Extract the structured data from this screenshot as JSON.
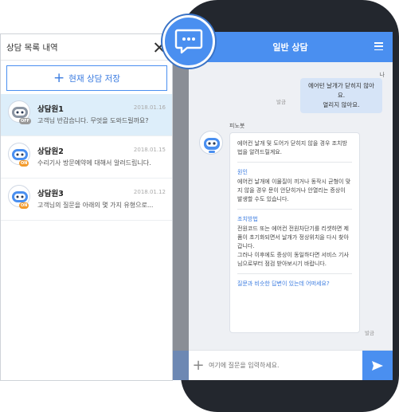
{
  "panel": {
    "title": "상담 목록 내역",
    "save_label": "현재 상담 저장",
    "items": [
      {
        "name": "상담원1",
        "date": "2018.01.16",
        "preview": "고객님 반갑습니다. 무엇을 도와드릴까요?",
        "status": "OFF"
      },
      {
        "name": "상담원2",
        "date": "2018.01.15",
        "preview": "수리기사 방문예약에 대해서 알려드립니다.",
        "status": "ON"
      },
      {
        "name": "상담원3",
        "date": "2018.01.12",
        "preview": "고객님의 질문을 아래의 몇 가지 유형으로...",
        "status": "ON"
      }
    ]
  },
  "chat": {
    "title": "일반 상담",
    "user_name": "나",
    "user_message_line1": "에어턴 날개가 닫히지 않아요.",
    "user_message_line2": "열리지 않아요.",
    "user_time": "발금",
    "bot_name": "피노봇",
    "bot_intro": "에어컨 날개 및 도어가 닫히지 않을 경우 조치방법을 알려드릴게요.",
    "cause_title": "원인",
    "cause_text": "에어컨 날개에 이물질이 끼거나 동작시 균형이 맞지 않을 경우 문이 안닫히거나 안열리는 증상이 발생할 수도 있습니다.",
    "fix_title": "조치방법",
    "fix_text1": "전원코드 또는 에어컨 전원차단기를 리셋하면 제품이 초기화되면서 날개가 정상위치을 다시 찾아갑니다.",
    "fix_text2": "그러나 이후에도 증상이 동일하다면 서비스 기사님으로부터 점검 받아보시기 바랍니다.",
    "similar_link": "질문과 비슷한 답변이 있는데 어떠세요?",
    "bot_time": "발금",
    "input_placeholder": "여기에 질문을 입력하세요."
  },
  "icons": {
    "fab": "chat-bubble-icon",
    "menu": "hamburger-icon",
    "close": "close-icon",
    "send": "send-icon",
    "plus": "plus-icon",
    "avatar": "robot-icon"
  },
  "colors": {
    "accent": "#4a8ff0",
    "active_row": "#ddeefa",
    "badge_on": "#f39a2b",
    "badge_off": "#999999"
  }
}
